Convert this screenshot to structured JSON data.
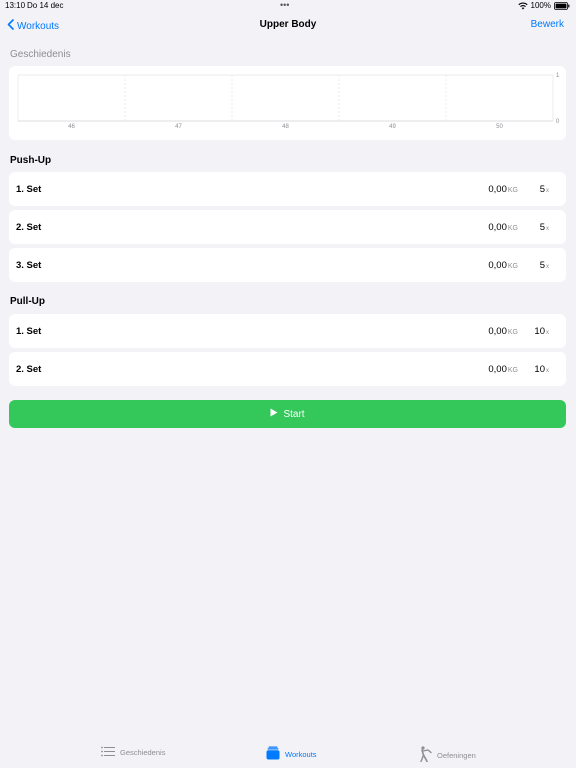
{
  "status_bar": {
    "time": "13:10",
    "date": "Do 14 dec",
    "dots": "•••",
    "battery": "100%"
  },
  "nav": {
    "back_label": "Workouts",
    "title": "Upper Body",
    "edit_label": "Bewerk"
  },
  "history": {
    "label": "Geschiedenis"
  },
  "chart_data": {
    "type": "line",
    "categories": [
      "46",
      "47",
      "48",
      "49",
      "50"
    ],
    "series": [],
    "ylim": [
      0,
      1
    ],
    "y_ticks": [
      "1",
      "0"
    ],
    "grid": true
  },
  "exercises": [
    {
      "name": "Push-Up",
      "sets": [
        {
          "label": "1. Set",
          "weight": "0,00",
          "weight_unit": "KG",
          "reps": "5",
          "reps_unit": "x"
        },
        {
          "label": "2. Set",
          "weight": "0,00",
          "weight_unit": "KG",
          "reps": "5",
          "reps_unit": "x"
        },
        {
          "label": "3. Set",
          "weight": "0,00",
          "weight_unit": "KG",
          "reps": "5",
          "reps_unit": "x"
        }
      ]
    },
    {
      "name": "Pull-Up",
      "sets": [
        {
          "label": "1. Set",
          "weight": "0,00",
          "weight_unit": "KG",
          "reps": "10",
          "reps_unit": "x"
        },
        {
          "label": "2. Set",
          "weight": "0,00",
          "weight_unit": "KG",
          "reps": "10",
          "reps_unit": "x"
        }
      ]
    }
  ],
  "start_button": {
    "label": "Start",
    "color": "#34c759"
  },
  "tabs": [
    {
      "label": "Geschiedenis",
      "icon": "list-icon"
    },
    {
      "label": "Workouts",
      "icon": "workouts-stack-icon"
    },
    {
      "label": "Oefeningen",
      "icon": "figure-stretch-icon"
    }
  ],
  "colors": {
    "accent": "#007aff",
    "background": "#f2f2f7"
  }
}
